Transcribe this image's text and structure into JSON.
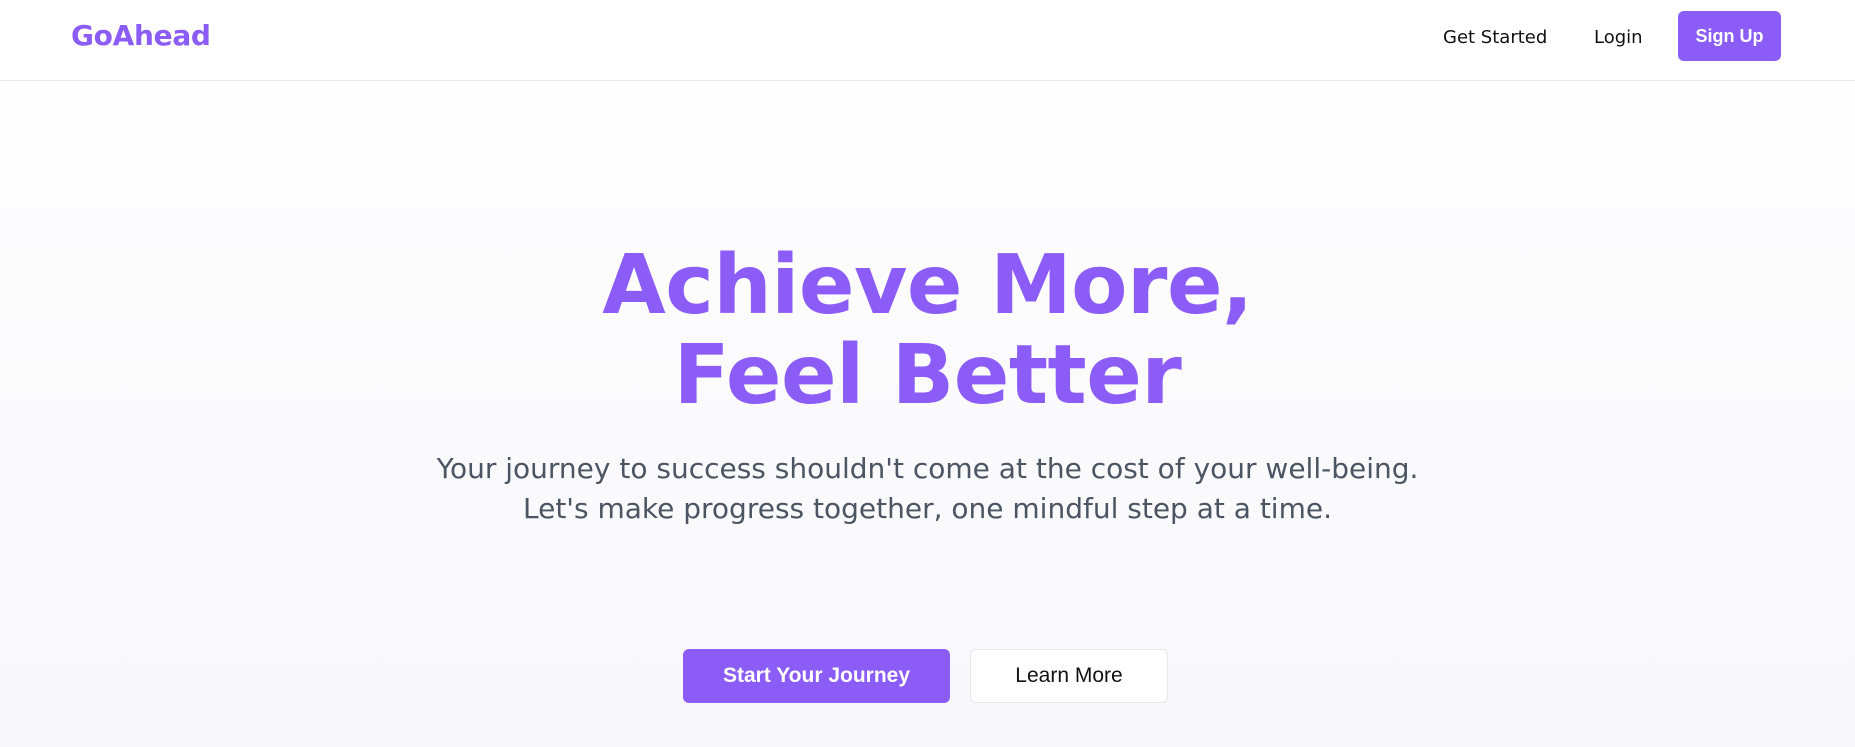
{
  "brand": {
    "name": "GoAhead",
    "accent_color": "#8b5cf6"
  },
  "nav": {
    "get_started": "Get Started",
    "login": "Login",
    "signup": "Sign Up"
  },
  "hero": {
    "headline_line1": "Achieve More,",
    "headline_line2": "Feel Better",
    "subtext_line1": "Your journey to success shouldn't come at the cost of your well-being.",
    "subtext_line2": "Let's make progress together, one mindful step at a time.",
    "primary_cta": "Start Your Journey",
    "secondary_cta": "Learn More"
  }
}
